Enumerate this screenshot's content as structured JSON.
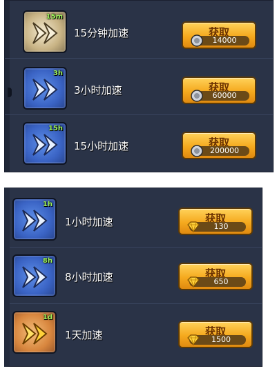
{
  "colors": {
    "panel_bg": "#2a3347",
    "button": "#f5a91e",
    "duration_text": "#9ef25b"
  },
  "button_label": "获取",
  "section1": {
    "currency_icon": "coin-icon",
    "items": [
      {
        "duration": "15m",
        "title": "15分钟加速",
        "price": "14000",
        "icon": "speedup-arrows-icon"
      },
      {
        "duration": "3h",
        "title": "3小时加速",
        "price": "60000",
        "icon": "speedup-arrows-icon"
      },
      {
        "duration": "15h",
        "title": "15小时加速",
        "price": "200000",
        "icon": "speedup-arrows-icon"
      }
    ]
  },
  "section2": {
    "currency_icon": "gem-icon",
    "items": [
      {
        "duration": "1h",
        "title": "1小时加速",
        "price": "130",
        "icon": "speedup-arrows-icon"
      },
      {
        "duration": "8h",
        "title": "8小时加速",
        "price": "650",
        "icon": "speedup-arrows-icon"
      },
      {
        "duration": "1d",
        "title": "1天加速",
        "price": "1500",
        "icon": "speedup-arrows-icon"
      }
    ]
  }
}
